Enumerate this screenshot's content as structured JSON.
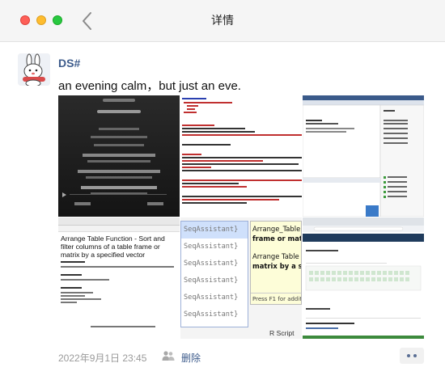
{
  "window": {
    "title": "详情"
  },
  "post": {
    "username": "DS#",
    "text": "an evening calm，but just an eve.",
    "timestamp": "2022年9月1日 23:45",
    "delete_label": "删除"
  },
  "images": [
    {
      "name": "lyrics-screenshot"
    },
    {
      "name": "code-screenshot"
    },
    {
      "name": "ide-screenshot"
    },
    {
      "name": "r-documentation-screenshot",
      "heading": "Arrange Table Function - Sort and filter columns of a table frame or matrix by a specified vector"
    },
    {
      "name": "autocomplete-screenshot",
      "suggestions": [
        "SeqAssistant}",
        "SeqAssistant}",
        "SeqAssistant}",
        "SeqAssistant}",
        "SeqAssistant}",
        "SeqAssistant}"
      ],
      "tooltip_lines": [
        "Arrange_Table",
        "frame or mat",
        "Arrange Table",
        "matrix by a sp"
      ],
      "tooltip_hint": "Press F1 for additi",
      "status": "R Script"
    },
    {
      "name": "browser-screenshot"
    }
  ],
  "colors": {
    "link": "#3e5c8c",
    "meta": "#9a9a9a"
  }
}
